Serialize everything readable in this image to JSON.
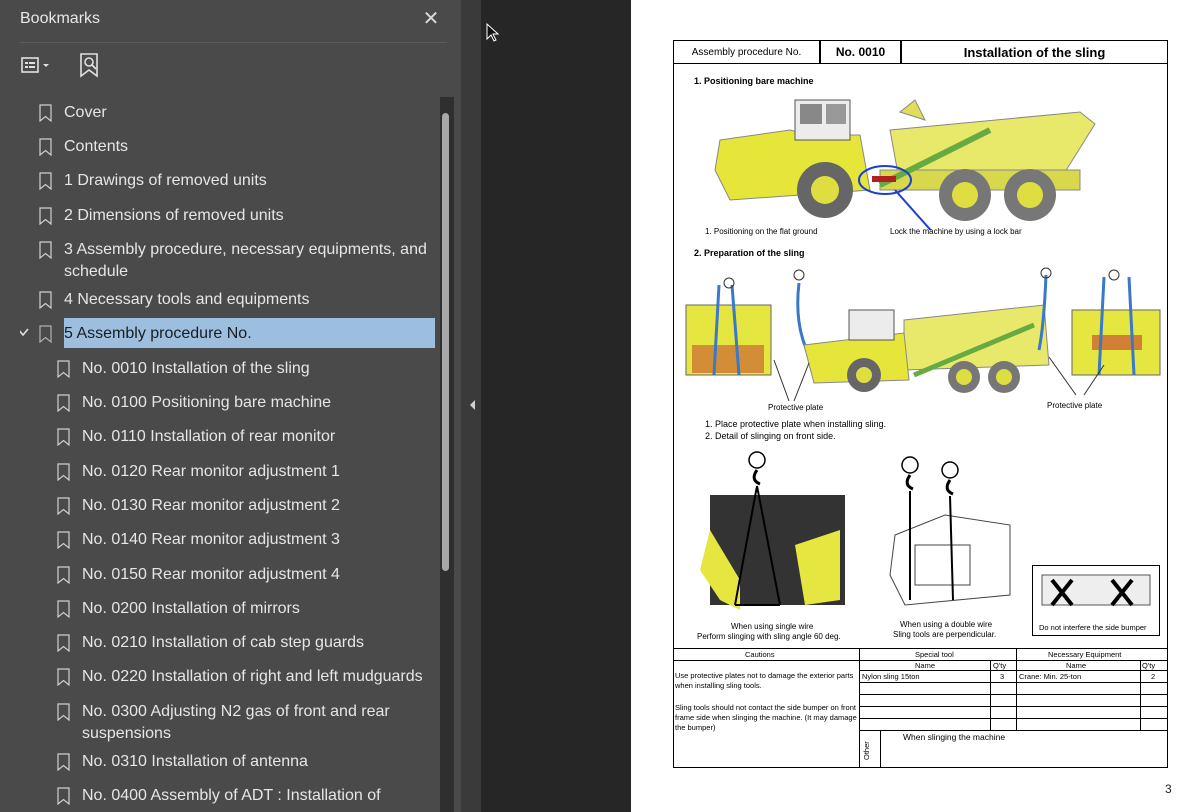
{
  "sidebar": {
    "title": "Bookmarks",
    "close_icon": "close-icon",
    "options_icon": "options-menu-icon",
    "find_icon": "find-bookmark-icon",
    "items": [
      {
        "label": "Cover",
        "level": 0
      },
      {
        "label": "Contents",
        "level": 0
      },
      {
        "label": "1  Drawings of removed units",
        "level": 0
      },
      {
        "label": "2  Dimensions of removed units",
        "level": 0
      },
      {
        "label": "3  Assembly procedure, necessary equipments, and schedule",
        "level": 0
      },
      {
        "label": "4  Necessary tools and equipments",
        "level": 0
      },
      {
        "label": "5  Assembly procedure No.",
        "level": 0,
        "expanded": true,
        "selected": true
      },
      {
        "label": "No. 0010  Installation of the sling",
        "level": 1
      },
      {
        "label": "No. 0100  Positioning bare machine",
        "level": 1
      },
      {
        "label": "No. 0110  Installation of rear monitor",
        "level": 1
      },
      {
        "label": "No. 0120  Rear monitor adjustment 1",
        "level": 1
      },
      {
        "label": "No. 0130  Rear monitor adjustment 2",
        "level": 1
      },
      {
        "label": "No. 0140  Rear monitor adjustment 3",
        "level": 1
      },
      {
        "label": "No. 0150  Rear monitor adjustment 4",
        "level": 1
      },
      {
        "label": "No. 0200  Installation of mirrors",
        "level": 1
      },
      {
        "label": "No. 0210  Installation of cab step guards",
        "level": 1
      },
      {
        "label": "No. 0220  Installation of right and left mudguards",
        "level": 1
      },
      {
        "label": "No. 0300  Adjusting N2 gas of front and rear suspensions",
        "level": 1
      },
      {
        "label": "No. 0310  Installation of antenna",
        "level": 1
      },
      {
        "label": "No. 0400  Assembly of ADT : Installation of",
        "level": 1
      }
    ]
  },
  "doc": {
    "header": {
      "label": "Assembly procedure No.",
      "number": "No. 0010",
      "title": "Installation of the sling"
    },
    "section1": {
      "heading": "1. Positioning bare machine",
      "caption_left": "1. Positioning on the flat ground",
      "caption_right": "Lock the machine by using a lock bar"
    },
    "section2": {
      "heading": "2. Preparation of the sling",
      "plate_left": "Protective plate",
      "plate_right": "Protective plate",
      "note1": "1. Place protective plate when installing sling.",
      "note2": "2. Detail of slinging on front side.",
      "single_wire_1": "When using single wire",
      "single_wire_2": "Perform slinging with sling angle 60 deg.",
      "double_wire_1": "When using a double wire",
      "double_wire_2": "Sling tools are perpendicular.",
      "bumper_note": "Do not interfere the side bumper"
    },
    "table": {
      "cautions_header": "Cautions",
      "special_tool_header": "Special tool",
      "equipment_header": "Necessary Equipment",
      "name_header": "Name",
      "qty_header": "Q'ty",
      "caution_1": "Use protective plates not to damage the exterior parts when installing sling tools.",
      "caution_2": "Sling tools should not contact the side bumper on front frame side when slinging the machine. (It may damage the bumper)",
      "tool_name": "Nylon sling  15ton",
      "tool_qty": "3",
      "equip_name": "Crane:  Min. 25-ton",
      "equip_qty": "2",
      "other_label": "Other",
      "other_text": "When slinging the machine"
    },
    "page_number": "3"
  }
}
